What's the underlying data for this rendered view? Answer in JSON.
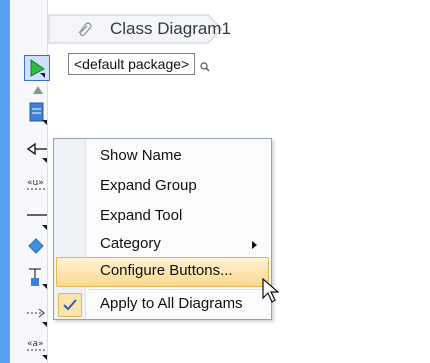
{
  "breadcrumb": {
    "diagram_name": "Class Diagram1",
    "icon": "diagram-link-icon"
  },
  "package_selector": {
    "label": "<default package>",
    "icon": "search-icon"
  },
  "palette": {
    "tools": [
      {
        "name": "selector-tool",
        "icon": "pointer-icon",
        "selected": true
      },
      {
        "name": "collapse-arrow",
        "icon": "triangle-up-icon"
      },
      {
        "name": "class-tool",
        "icon": "class-icon"
      },
      {
        "name": "generalization-tool",
        "icon": "generalization-icon"
      },
      {
        "name": "usage-tool",
        "icon": "usage-icon",
        "text": "«u»"
      },
      {
        "name": "association-tool",
        "icon": "association-icon"
      },
      {
        "name": "interface-tool",
        "icon": "interface-icon"
      },
      {
        "name": "dependency-tool",
        "icon": "dependency-icon"
      },
      {
        "name": "realization-tool",
        "icon": "realization-icon"
      },
      {
        "name": "anchor-tool",
        "icon": "anchor-icon",
        "text": "«a»"
      }
    ]
  },
  "context_menu": {
    "items": [
      {
        "label": "Show Name"
      },
      {
        "label": "Expand Group"
      },
      {
        "label": "Expand Tool"
      },
      {
        "label": "Category",
        "submenu": true
      },
      {
        "label": "Configure Buttons...",
        "highlighted": true
      },
      {
        "label": "Apply to All Diagrams",
        "checked": true
      }
    ]
  },
  "colors": {
    "accent": "#5aa0f0",
    "highlight": "#fbd98d",
    "selection": "#cfe0fb"
  }
}
